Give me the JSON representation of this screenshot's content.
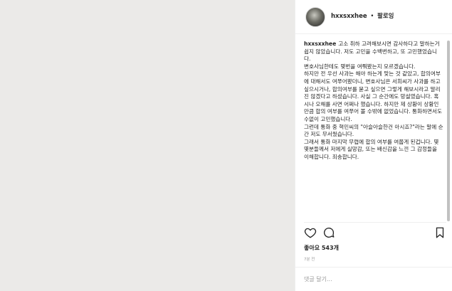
{
  "header": {
    "username": "hxxsxxhee",
    "separator": "•",
    "follow_label": "팔로잉"
  },
  "caption": {
    "username": "hxxsxxhee",
    "lines": [
      "고소 취하 고려해보시면 감사하다고 말하는거 쉽지 않았습니다. 저도 고민을 수백번하고, 또 고민했었습니다.",
      "변호사님한테도 몇번을 여쭤봤는지 모르겠습니다.",
      "하지만 전 우선 사과는 해야 하는게 맞는 것 같았고, 합의여부에 대해서도 여쭈어봤더니, 변호사님은 서희씨가 사과를 하고 싶으시거나, 합의여부를 묻고 싶으면 그렇게 해보시라고 말리진 않겠다고 하셨습니다. 사실 그 순간에도 망설였습니다. 혹시나 오해를 사면 어쩌나 했습니다. 하지만 제 상황이 상황인만큼 합의 여부를 여쭈어 볼 수밖에 없었습니다. 통화하면서도 수없이 고민했습니다.",
      "그런데 통화 중 혁민씨의 \"아슬아슬한건 아시죠?\"라는 말에 순간 저도 무서웠습니다.",
      "그래서 통화 마지막 무렵에 합의 여부를 여쭙게 된겁니다. 몇몇분들께서 저에게 실망감, 또는 배신감을 느낀 그 감정들을 이해합니다. 죄송합니다."
    ]
  },
  "actions": {
    "like_icon": "heart-outline",
    "comment_icon": "speech-bubble",
    "save_icon": "bookmark-outline"
  },
  "likes_text": "좋아요 543개",
  "timestamp": "7분 전",
  "comment": {
    "placeholder": "댓글 달기...",
    "value": ""
  }
}
